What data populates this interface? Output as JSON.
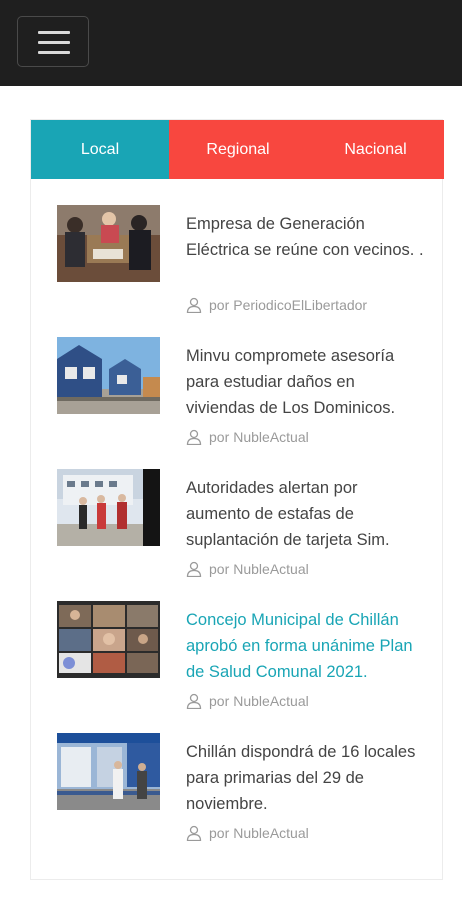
{
  "header": {
    "menu_icon": "hamburger-menu-icon"
  },
  "tabs": [
    {
      "label": "Local",
      "color": "#19a5b5",
      "active": true
    },
    {
      "label": "Regional",
      "color": "#f8473f",
      "active": false
    },
    {
      "label": "Nacional",
      "color": "#f8473f",
      "active": false
    }
  ],
  "articles": [
    {
      "title": "Empresa de Generación Eléctrica se reúne con vecinos. .",
      "by": "por",
      "author": "PeriodicoElLibertador"
    },
    {
      "title": "Minvu compromete asesoría para estudiar daños en viviendas de Los Dominicos.",
      "by": "por",
      "author": "NubleActual"
    },
    {
      "title": "Autoridades alertan por aumento de estafas de suplantación de tarjeta Sim.",
      "by": "por",
      "author": "NubleActual"
    },
    {
      "title": "Concejo Municipal de Chillán aprobó en forma unánime Plan de Salud Comunal 2021.",
      "by": "por",
      "author": "NubleActual",
      "highlighted": true
    },
    {
      "title": "Chillán dispondrá de 16 locales para primarias del 29 de noviembre.",
      "by": "por",
      "author": "NubleActual"
    }
  ],
  "colors": {
    "accent": "#19a5b5",
    "secondary": "#f8473f",
    "header_bg": "#1f1f1f"
  }
}
